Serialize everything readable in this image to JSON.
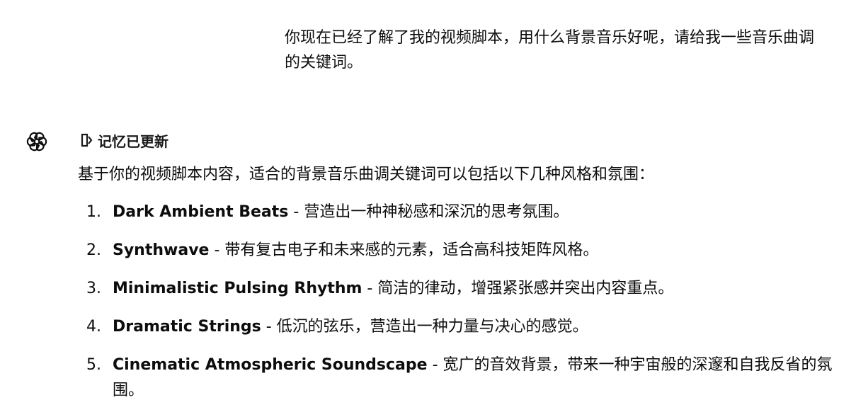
{
  "user_message": {
    "text": "你现在已经了解了我的视频脚本，用什么背景音乐好呢，请给我一些音乐曲调的关键词。"
  },
  "assistant": {
    "avatar_icon": "openai-logo-icon",
    "memory_note": "记忆已更新",
    "memory_icon": "memory-icon",
    "intro": "基于你的视频脚本内容，适合的背景音乐曲调关键词可以包括以下几种风格和氛围：",
    "items": [
      {
        "number": "1.",
        "keyword": "Dark Ambient Beats",
        "description": " - 营造出一种神秘感和深沉的思考氛围。"
      },
      {
        "number": "2.",
        "keyword": "Synthwave",
        "description": " - 带有复古电子和未来感的元素，适合高科技矩阵风格。"
      },
      {
        "number": "3.",
        "keyword": "Minimalistic Pulsing Rhythm",
        "description": " - 简洁的律动，增强紧张感并突出内容重点。"
      },
      {
        "number": "4.",
        "keyword": "Dramatic Strings",
        "description": " - 低沉的弦乐，营造出一种力量与决心的感觉。"
      },
      {
        "number": "5.",
        "keyword": "Cinematic Atmospheric Soundscape",
        "description": " - 宽广的音效背景，带来一种宇宙般的深邃和自我反省的氛围。"
      }
    ]
  }
}
